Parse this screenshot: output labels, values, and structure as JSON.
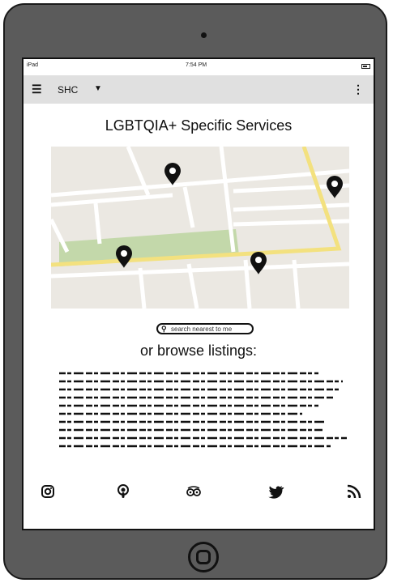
{
  "status_bar": {
    "carrier": "iPad",
    "time": "7:54 PM"
  },
  "app_bar": {
    "brand": "SHC",
    "menu_icon": "hamburger-icon",
    "more_icon": "kebab-icon"
  },
  "page": {
    "title": "LGBTQIA+ Specific Services",
    "search_placeholder": "search nearest to me",
    "browse_label": "or browse listings:"
  },
  "social": [
    "instagram-icon",
    "podcast-icon",
    "tripadvisor-icon",
    "twitter-icon",
    "rss-icon"
  ]
}
